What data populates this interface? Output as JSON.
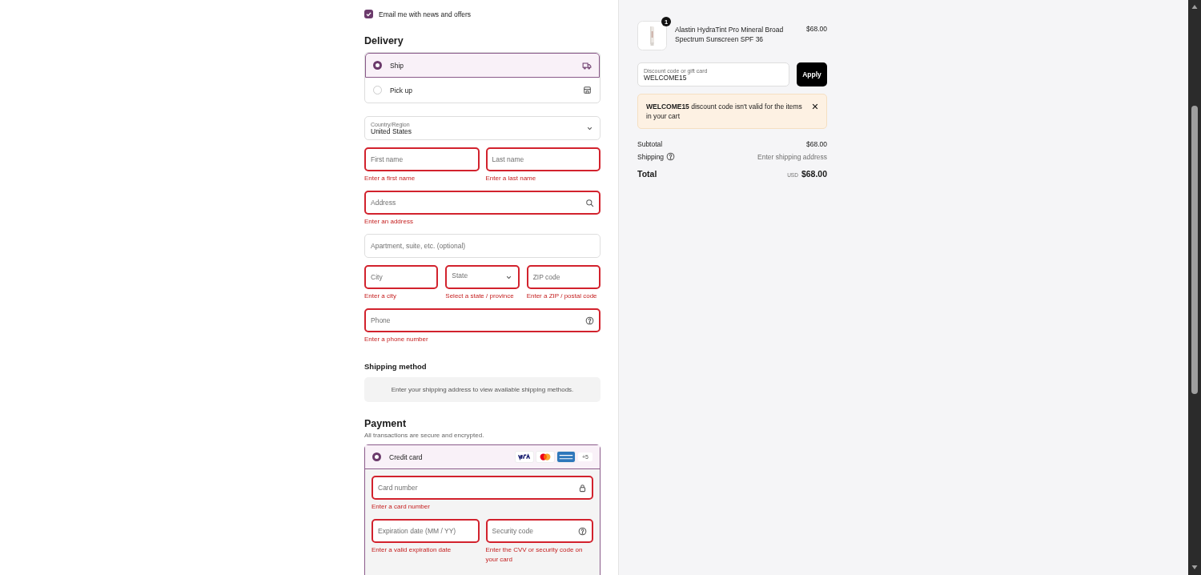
{
  "newsletter": {
    "label": "Email me with news and offers",
    "checked": true
  },
  "delivery": {
    "title": "Delivery",
    "options": [
      {
        "label": "Ship",
        "kind": "ship",
        "selected": true
      },
      {
        "label": "Pick up",
        "kind": "pickup",
        "selected": false
      }
    ]
  },
  "address_rows": [
    [
      {
        "kind": "select",
        "label": "Country/Region",
        "value": "United States",
        "invalid": false
      }
    ],
    [
      {
        "kind": "text",
        "placeholder": "First name",
        "invalid": true,
        "error": "Enter a first name"
      },
      {
        "kind": "text",
        "placeholder": "Last name",
        "invalid": true,
        "error": "Enter a last name"
      }
    ],
    [
      {
        "kind": "address",
        "placeholder": "Address",
        "invalid": true,
        "error": "Enter an address"
      }
    ],
    [
      {
        "kind": "text",
        "placeholder": "Apartment, suite, etc. (optional)",
        "invalid": false
      }
    ],
    [
      {
        "kind": "text",
        "placeholder": "City",
        "invalid": true,
        "error": "Enter a city"
      },
      {
        "kind": "select",
        "placeholder": "State",
        "invalid": true,
        "error": "Select a state / province"
      },
      {
        "kind": "text",
        "placeholder": "ZIP code",
        "invalid": true,
        "error": "Enter a ZIP / postal code"
      }
    ],
    [
      {
        "kind": "phone",
        "placeholder": "Phone",
        "invalid": true,
        "error": "Enter a phone number"
      }
    ]
  ],
  "shipping_method": {
    "title": "Shipping method",
    "notice": "Enter your shipping address to view available shipping methods."
  },
  "payment": {
    "title": "Payment",
    "subtitle": "All transactions are secure and encrypted.",
    "method": {
      "label": "Credit card",
      "selected": true,
      "more": "+5"
    },
    "card_rows": [
      [
        {
          "kind": "card_number",
          "placeholder": "Card number",
          "invalid": true,
          "error": "Enter a card number"
        }
      ],
      [
        {
          "kind": "text",
          "placeholder": "Expiration date (MM / YY)",
          "invalid": true,
          "error": "Enter a valid expiration date"
        },
        {
          "kind": "security_code",
          "placeholder": "Security code",
          "invalid": true,
          "error": "Enter the CVV or security code on your card"
        }
      ]
    ]
  },
  "summary": {
    "product": {
      "name": "Alastin HydraTint Pro Mineral Broad Spectrum Sunscreen SPF 36",
      "price": "$68.00",
      "quantity": "1"
    },
    "discount": {
      "label": "Discount code or gift card",
      "value": "WELCOME15",
      "button": "Apply"
    },
    "alert": "**WELCOME15** discount code isn't valid for the items in your cart",
    "lines": [
      {
        "label": "Subtotal",
        "value": "$68.00",
        "help": false
      },
      {
        "label": "Shipping",
        "value": "Enter shipping address",
        "help": true
      }
    ],
    "total": {
      "label": "Total",
      "currency": "USD",
      "amount": "$68.00"
    }
  }
}
